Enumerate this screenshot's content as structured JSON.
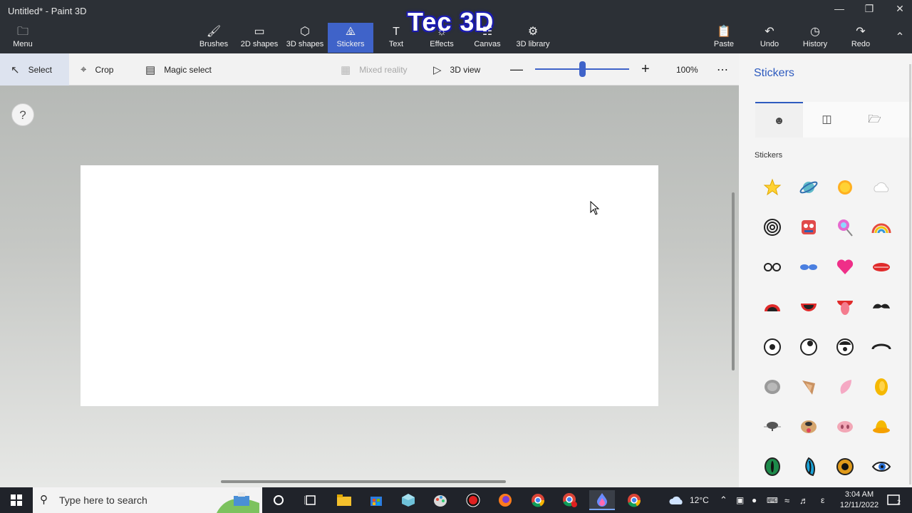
{
  "window": {
    "title": "Untitled* - Paint 3D"
  },
  "watermark": "Tec 3D",
  "menu": {
    "label": "Menu"
  },
  "ribbon": {
    "tools": [
      {
        "label": "Brushes",
        "icon": "brush-icon"
      },
      {
        "label": "2D shapes",
        "icon": "2d-shapes-icon"
      },
      {
        "label": "3D shapes",
        "icon": "3d-shapes-icon"
      },
      {
        "label": "Stickers",
        "icon": "stickers-icon",
        "active": true
      },
      {
        "label": "Text",
        "icon": "text-icon"
      },
      {
        "label": "Effects",
        "icon": "effects-icon"
      },
      {
        "label": "Canvas",
        "icon": "canvas-icon"
      },
      {
        "label": "3D library",
        "icon": "3d-library-icon"
      }
    ],
    "right": [
      {
        "label": "Paste",
        "icon": "paste-icon"
      },
      {
        "label": "Undo",
        "icon": "undo-icon"
      },
      {
        "label": "History",
        "icon": "history-icon"
      },
      {
        "label": "Redo",
        "icon": "redo-icon"
      }
    ]
  },
  "toolbar": {
    "select": "Select",
    "crop": "Crop",
    "magic_select": "Magic select",
    "mixed_reality": "Mixed reality",
    "view_3d": "3D view",
    "zoom_percent": "100%",
    "zoom_value": 0.5
  },
  "help": "?",
  "panel": {
    "title": "Stickers",
    "section": "Stickers",
    "tabs": [
      "stickers-tab-icon",
      "textures-tab-icon",
      "custom-sticker-icon"
    ],
    "stickers": [
      "star-sticker",
      "planet-sticker",
      "sun-sticker",
      "cloud-sticker",
      "spiral-sticker",
      "face-sticker",
      "lollipop-sticker",
      "rainbow-sticker",
      "glasses-sticker",
      "sunglasses-sticker",
      "heart-sticker",
      "lips-sticker",
      "mouth-open-sticker",
      "mouth-smile-sticker",
      "tongue-sticker",
      "mustache-sticker",
      "eye-sticker",
      "eye-up-sticker",
      "eye-worried-sticker",
      "eyebrow-sticker",
      "ear-gray-sticker",
      "ear-brown-sticker",
      "ear-pink-sticker",
      "ear-yellow-sticker",
      "nose-bear-sticker",
      "nose-dog-sticker",
      "nose-pig-sticker",
      "nose-duck-sticker",
      "eye-green-sticker",
      "eye-cat-sticker",
      "eye-orange-sticker",
      "eye-lash-sticker"
    ]
  },
  "taskbar": {
    "search_placeholder": "Type here to search",
    "weather": "12°C",
    "time": "3:04 AM",
    "date": "12/11/2022",
    "notification_count": "2"
  },
  "colors": {
    "accent": "#3f63c9",
    "panel_title": "#2e5bbf"
  }
}
